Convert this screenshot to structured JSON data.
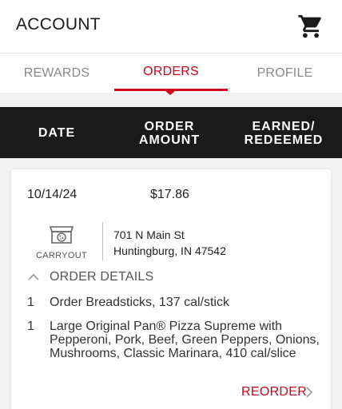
{
  "header": {
    "title": "ACCOUNT",
    "cart_icon": "shopping-cart-icon"
  },
  "tabs": [
    {
      "label": "REWARDS",
      "active": false
    },
    {
      "label": "ORDERS",
      "active": true
    },
    {
      "label": "PROFILE",
      "active": false
    }
  ],
  "table_header": {
    "date": "DATE",
    "amount_line1": "ORDER",
    "amount_line2": "AMOUNT",
    "earned_line1": "EARNED/",
    "earned_line2": "REDEEMED"
  },
  "order": {
    "date": "10/14/24",
    "amount": "$17.86",
    "fulfillment": {
      "label": "CARRYOUT",
      "icon": "carryout-box-icon"
    },
    "address": {
      "line1": "701 N Main St",
      "line2": "Huntingburg, IN 47542"
    },
    "details_label": "ORDER DETAILS",
    "items": [
      {
        "qty": "1",
        "description": "Order Breadsticks, 137 cal/stick"
      },
      {
        "qty": "1",
        "description": "Large Original Pan® Pizza Supreme with Pepperoni, Pork, Beef, Green Peppers, Onions, Mushrooms, Classic Marinara, 410 cal/slice"
      }
    ],
    "reorder_label": "REORDER"
  },
  "colors": {
    "accent": "#d0021b",
    "header_bar": "#1a1a1a",
    "background": "#f2f2f2"
  }
}
